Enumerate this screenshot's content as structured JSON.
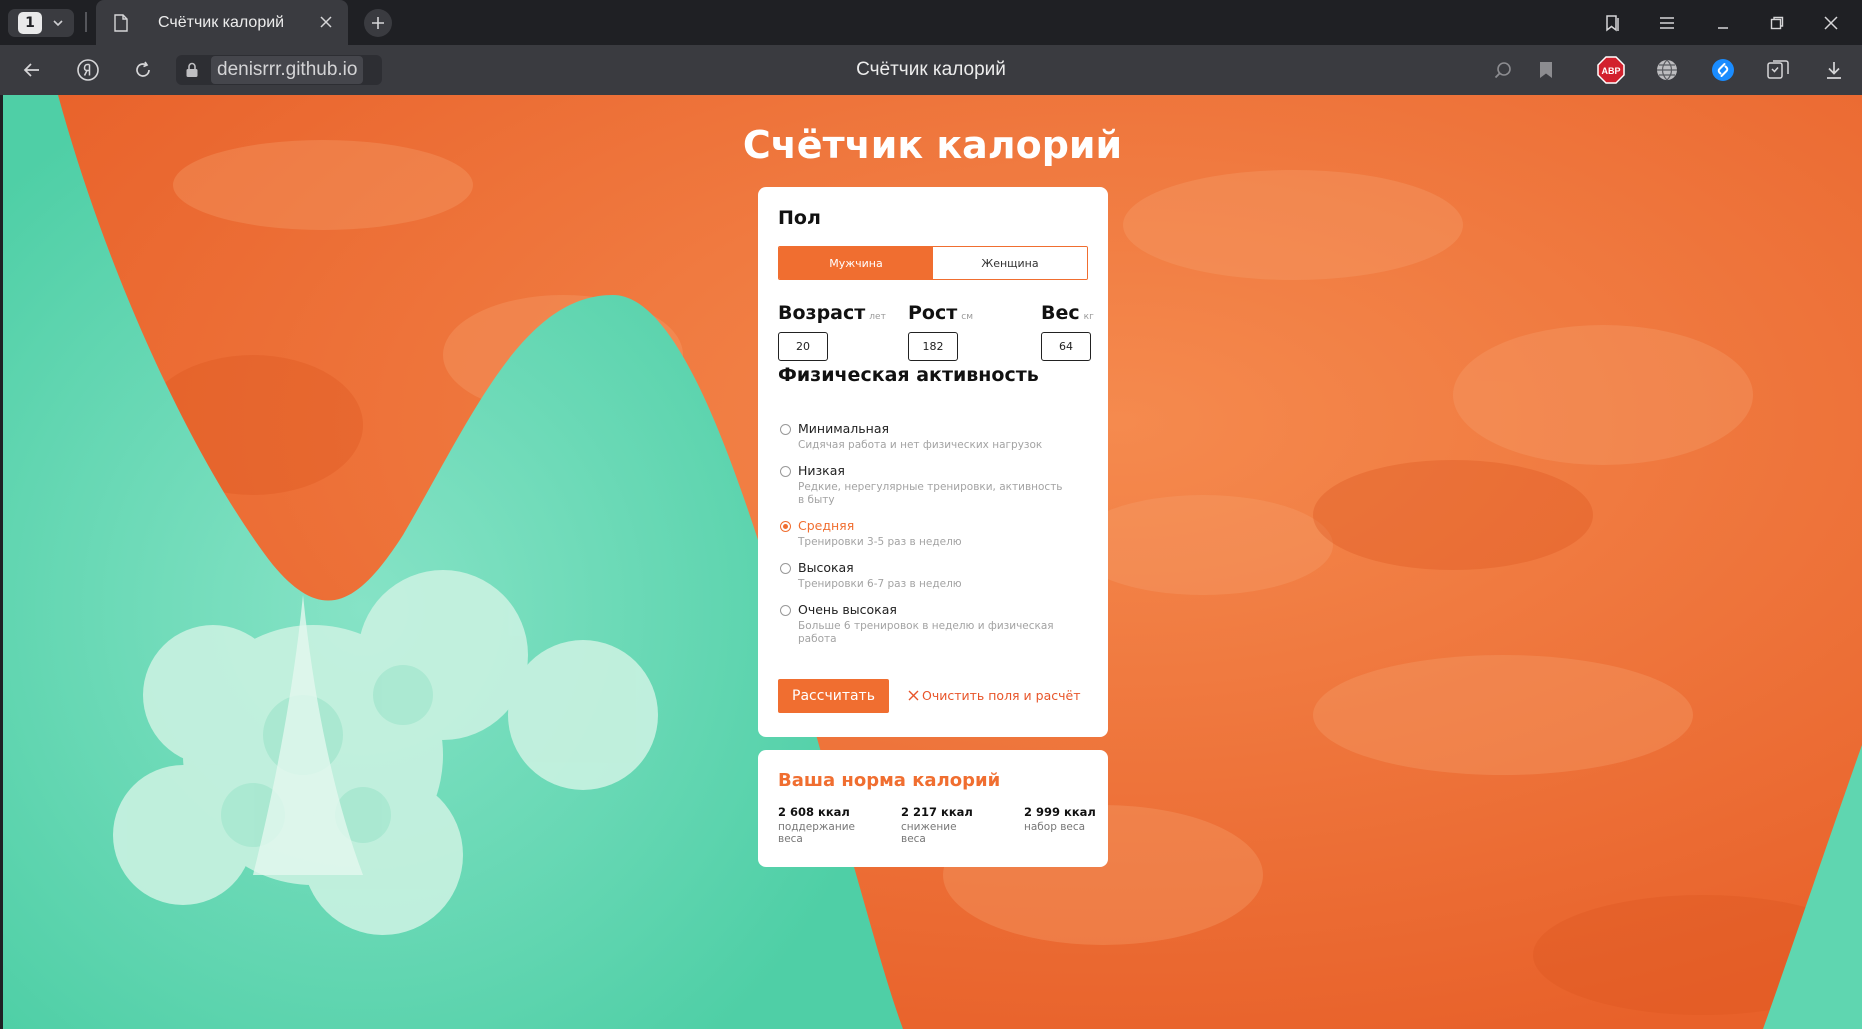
{
  "browser": {
    "tab_count": "1",
    "tab_title": "Счётчик калорий",
    "url": "denisrrr.github.io",
    "page_title": "Счётчик калорий"
  },
  "app": {
    "title": "Счётчик калорий",
    "gender": {
      "label": "Пол",
      "options": [
        "Мужчина",
        "Женщина"
      ],
      "selected": "Мужчина"
    },
    "params": {
      "age": {
        "label": "Возраст",
        "unit": "лет",
        "value": "20"
      },
      "height": {
        "label": "Рост",
        "unit": "см",
        "value": "182"
      },
      "weight": {
        "label": "Вес",
        "unit": "кг",
        "value": "64"
      }
    },
    "activity": {
      "label": "Физическая активность",
      "items": [
        {
          "title": "Минимальная",
          "desc": "Сидячая работа и нет физических нагрузок",
          "selected": false
        },
        {
          "title": "Низкая",
          "desc": "Редкие, нерегулярные тренировки, активность в быту",
          "selected": false
        },
        {
          "title": "Средняя",
          "desc": "Тренировки 3-5 раз в неделю",
          "selected": true
        },
        {
          "title": "Высокая",
          "desc": "Тренировки 6-7 раз в неделю",
          "selected": false
        },
        {
          "title": "Очень высокая",
          "desc": "Больше 6 тренировок в неделю и физическая работа",
          "selected": false
        }
      ]
    },
    "buttons": {
      "calculate": "Рассчитать",
      "reset": "Очистить поля и расчёт"
    },
    "result": {
      "title": "Ваша норма калорий",
      "items": [
        {
          "value": "2 608 ккал",
          "caption": "поддержание веса"
        },
        {
          "value": "2 217 ккал",
          "caption": "снижение веса"
        },
        {
          "value": "2 999 ккал",
          "caption": "набор веса"
        }
      ]
    }
  },
  "colors": {
    "accent": "#f06e30",
    "mint": "#5ed7b0",
    "chrome_dark": "#1f2024",
    "chrome_mid": "#3a3b40"
  }
}
